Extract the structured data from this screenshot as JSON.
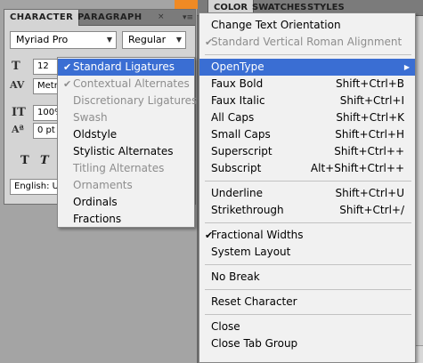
{
  "character_panel": {
    "tabs": [
      "CHARACTER",
      "PARAGRAPH"
    ],
    "font_family": "Myriad Pro",
    "font_style": "Regular",
    "font_size": "12 pt",
    "kerning": "Metr",
    "vertical_scale": "100%",
    "baseline_shift": "0 pt",
    "language": "English: U"
  },
  "right_panel": {
    "tabs": [
      "COLOR",
      "SWATCHES",
      "STYLES"
    ]
  },
  "panel_menu": {
    "items": [
      {
        "label": "Change Text Orientation"
      },
      {
        "label": "Standard Vertical Roman Alignment",
        "checked": true
      },
      {
        "label": "OpenType"
      },
      {
        "label": "Faux Bold",
        "shortcut": "Shift+Ctrl+B"
      },
      {
        "label": "Faux Italic",
        "shortcut": "Shift+Ctrl+I"
      },
      {
        "label": "All Caps",
        "shortcut": "Shift+Ctrl+K"
      },
      {
        "label": "Small Caps",
        "shortcut": "Shift+Ctrl+H"
      },
      {
        "label": "Superscript",
        "shortcut": "Shift+Ctrl++"
      },
      {
        "label": "Subscript",
        "shortcut": "Alt+Shift+Ctrl++"
      },
      {
        "label": "Underline",
        "shortcut": "Shift+Ctrl+U"
      },
      {
        "label": "Strikethrough",
        "shortcut": "Shift+Ctrl+/"
      },
      {
        "label": "Fractional Widths",
        "checked": true
      },
      {
        "label": "System Layout"
      },
      {
        "label": "No Break"
      },
      {
        "label": "Reset Character"
      },
      {
        "label": "Close"
      },
      {
        "label": "Close Tab Group"
      }
    ]
  },
  "opentype_submenu": {
    "items": [
      {
        "label": "Standard Ligatures",
        "checked": true
      },
      {
        "label": "Contextual Alternates",
        "checked": true
      },
      {
        "label": "Discretionary Ligatures"
      },
      {
        "label": "Swash"
      },
      {
        "label": "Oldstyle"
      },
      {
        "label": "Stylistic Alternates"
      },
      {
        "label": "Titling Alternates"
      },
      {
        "label": "Ornaments"
      },
      {
        "label": "Ordinals"
      },
      {
        "label": "Fractions"
      }
    ]
  },
  "colors": {
    "highlight": "#3a6ed3",
    "disabled_text": "#8d8d8d",
    "menu_bg": "#f1f1f1",
    "tab_bar": "#7b7b7b"
  }
}
